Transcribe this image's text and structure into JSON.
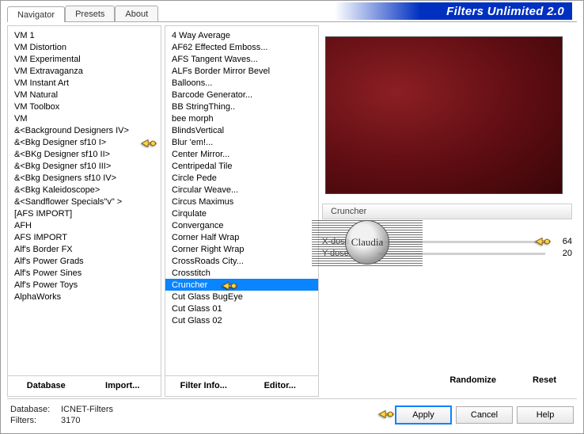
{
  "brand": "Filters Unlimited 2.0",
  "tabs": [
    "Navigator",
    "Presets",
    "About"
  ],
  "active_tab": 0,
  "categories": [
    "VM 1",
    "VM Distortion",
    "VM Experimental",
    "VM Extravaganza",
    "VM Instant Art",
    "VM Natural",
    "VM Toolbox",
    "VM",
    "&<Background Designers IV>",
    "&<Bkg Designer sf10 I>",
    "&<BKg Designer sf10 II>",
    "&<Bkg Designer sf10 III>",
    "&<Bkg Designers sf10 IV>",
    "&<Bkg Kaleidoscope>",
    "&<Sandflower Specials\"v\" >",
    "[AFS IMPORT]",
    "AFH",
    "AFS IMPORT",
    "Alf's Border FX",
    "Alf's Power Grads",
    "Alf's Power Sines",
    "Alf's Power Toys",
    "AlphaWorks"
  ],
  "cat_pointer_index": 9,
  "filters": [
    "4 Way Average",
    "AF62 Effected Emboss...",
    "AFS Tangent Waves...",
    "ALFs Border Mirror Bevel",
    "Balloons...",
    "Barcode Generator...",
    "BB StringThing..",
    "bee morph",
    "BlindsVertical",
    "Blur 'em!...",
    "Center Mirror...",
    "Centripedal Tile",
    "Circle Pede",
    "Circular Weave...",
    "Circus Maximus",
    "Cirqulate",
    "Convergance",
    "Corner Half Wrap",
    "Corner Right Wrap",
    "CrossRoads City...",
    "Crosstitch",
    "Cruncher",
    "Cut Glass  BugEye",
    "Cut Glass 01",
    "Cut Glass 02"
  ],
  "filter_selected_index": 21,
  "cat_buttons": {
    "db": "Database",
    "import": "Import..."
  },
  "filt_buttons": {
    "info": "Filter Info...",
    "editor": "Editor..."
  },
  "right_buttons": {
    "randomize": "Randomize",
    "reset": "Reset"
  },
  "selected_filter_label": "Cruncher",
  "params": [
    {
      "label": "X-dose",
      "value": "64"
    },
    {
      "label": "Y-dose",
      "value": "20"
    }
  ],
  "param_pointer_index": 0,
  "footer": {
    "db_label": "Database:",
    "db_value": "ICNET-Filters",
    "filters_label": "Filters:",
    "filters_value": "3170"
  },
  "action_buttons": {
    "apply": "Apply",
    "cancel": "Cancel",
    "help": "Help"
  },
  "watermark_text": "Claudia"
}
